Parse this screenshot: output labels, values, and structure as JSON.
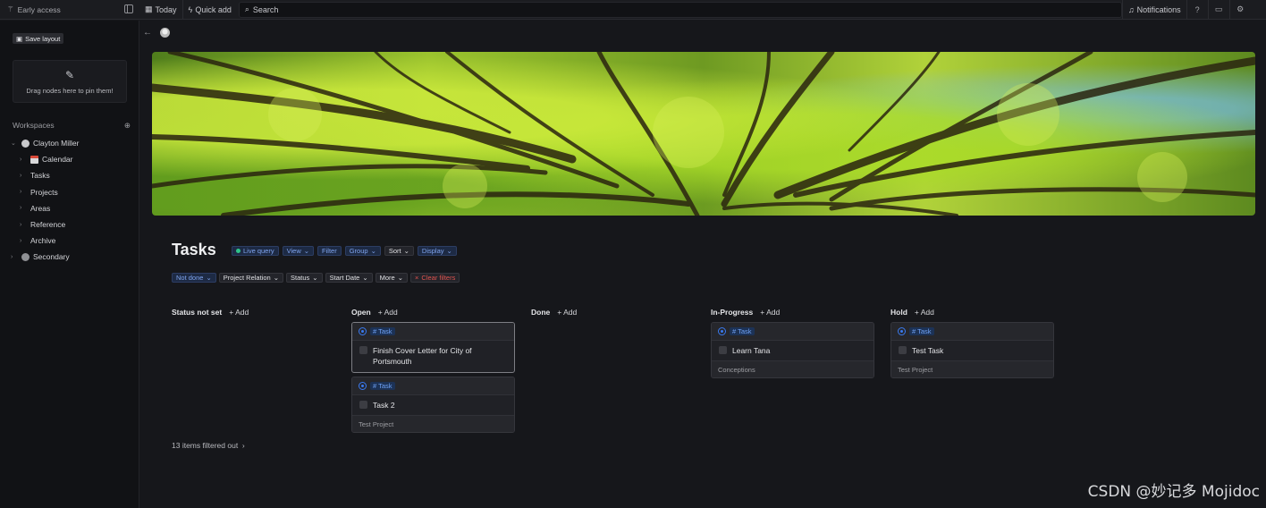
{
  "topbar": {
    "brand": "Early access",
    "today": "Today",
    "quick_add": "Quick add",
    "search_placeholder": "Search",
    "notifications": "Notifications"
  },
  "sidebar": {
    "save_layout": "Save layout",
    "pin_hint": "Drag nodes here to pin them!",
    "workspaces_label": "Workspaces",
    "workspace_user": "Clayton Miller",
    "items": [
      {
        "label": "Calendar"
      },
      {
        "label": "Tasks"
      },
      {
        "label": "Projects"
      },
      {
        "label": "Areas"
      },
      {
        "label": "Reference"
      },
      {
        "label": "Archive"
      }
    ],
    "secondary": "Secondary"
  },
  "page": {
    "title": "Tasks",
    "views": [
      "Live query",
      "View",
      "Filter",
      "Group",
      "Sort",
      "Display"
    ],
    "filters": [
      "Not done",
      "Project Relation",
      "Status",
      "Start Date",
      "More"
    ],
    "clear_filters": "Clear filters",
    "filtered_out": "13 items filtered out"
  },
  "board": {
    "add_label": "Add",
    "tag_label": "# Task",
    "columns": [
      {
        "name": "Status not set",
        "cards": []
      },
      {
        "name": "Open",
        "cards": [
          {
            "title": "Finish Cover Letter for City of Portsmouth",
            "footer": ""
          },
          {
            "title": "Task 2",
            "footer": "Test Project"
          }
        ]
      },
      {
        "name": "Done",
        "cards": []
      },
      {
        "name": "In-Progress",
        "cards": [
          {
            "title": "Learn Tana",
            "footer": "Conceptions"
          }
        ]
      },
      {
        "name": "Hold",
        "cards": [
          {
            "title": "Test Task",
            "footer": "Test Project"
          }
        ]
      }
    ]
  },
  "watermark": "CSDN @妙记多 Mojidoc"
}
